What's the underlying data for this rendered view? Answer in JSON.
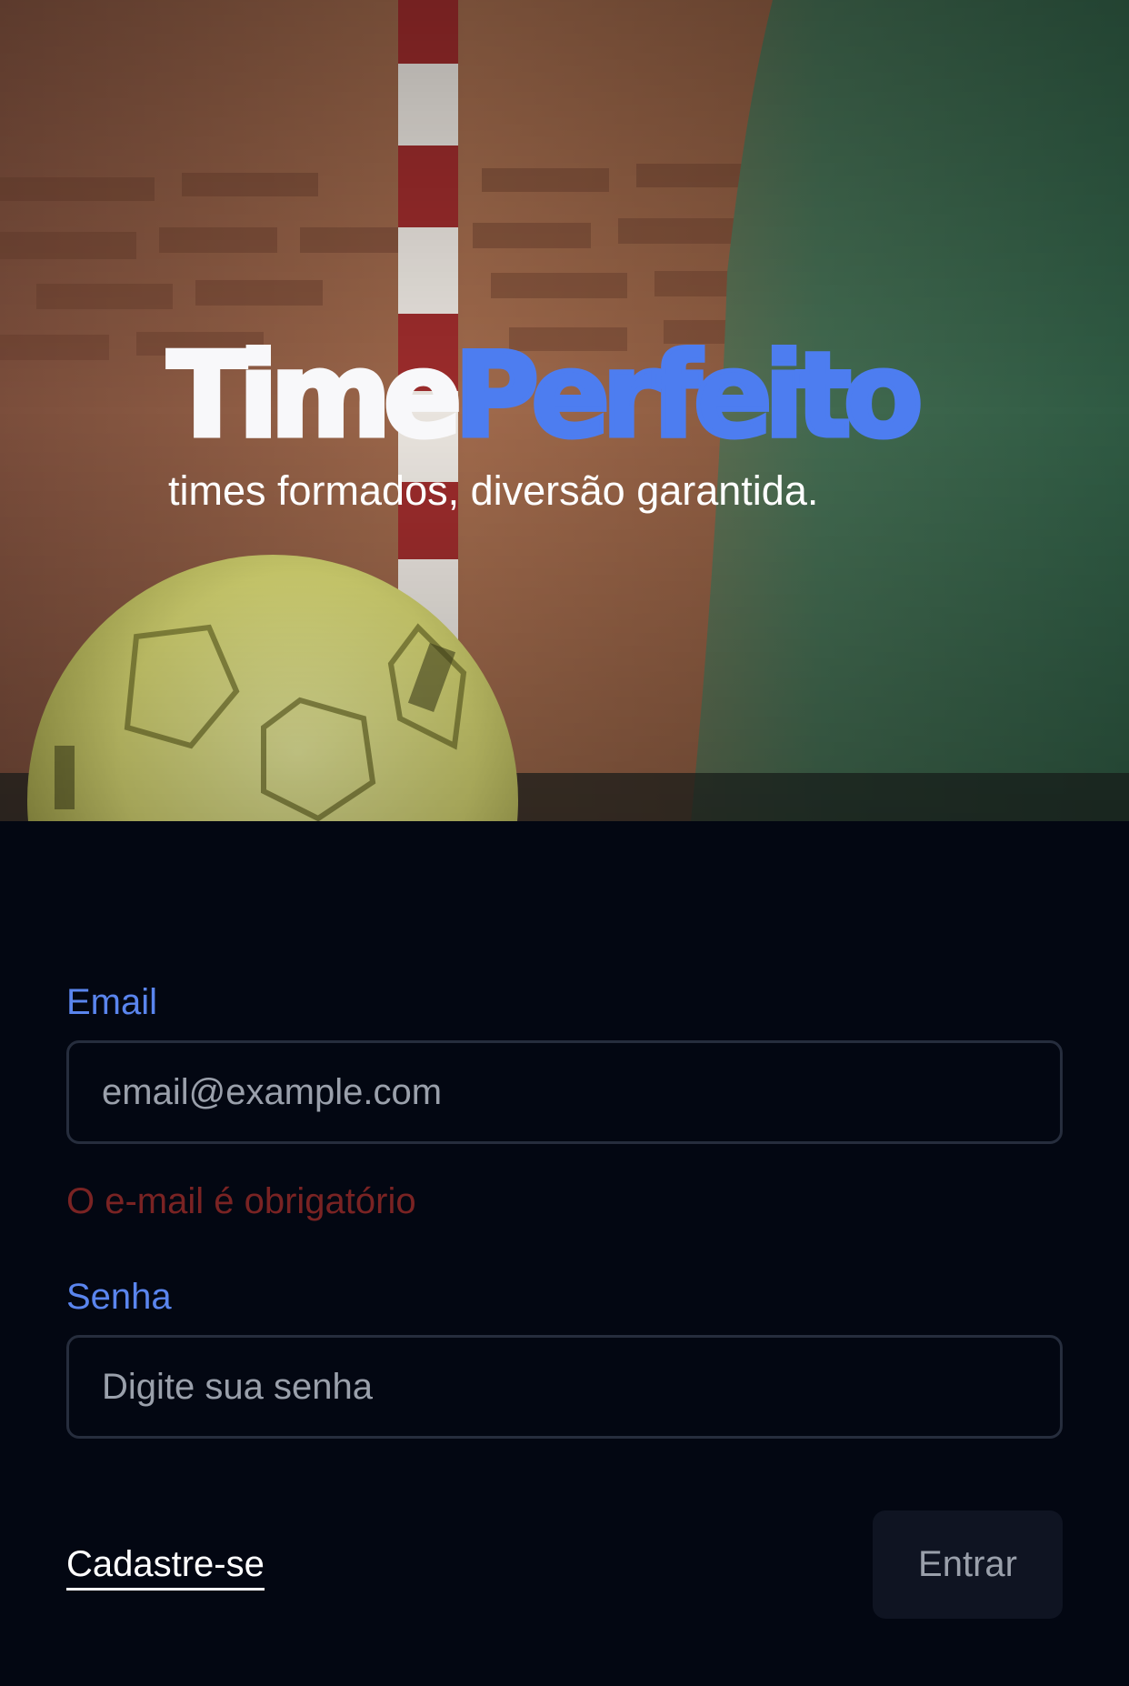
{
  "hero": {
    "logo_part1": "Time",
    "logo_part2": "Perfeito",
    "tagline": "times formados, diversão garantida.",
    "image": "futsal-ball-and-goal-post-photo"
  },
  "form": {
    "email": {
      "label": "Email",
      "placeholder": "email@example.com",
      "value": "",
      "error": "O e-mail é obrigatório"
    },
    "password": {
      "label": "Senha",
      "placeholder": "Digite sua senha",
      "value": ""
    },
    "signup_label": "Cadastre-se",
    "submit_label": "Entrar"
  },
  "colors": {
    "background": "#030712",
    "accent": "#4d7df0",
    "label": "#5a85ee",
    "error": "#7a2323",
    "button_bg": "#0f1422",
    "button_text": "#9aa0ab",
    "input_border": "#262d3d"
  }
}
